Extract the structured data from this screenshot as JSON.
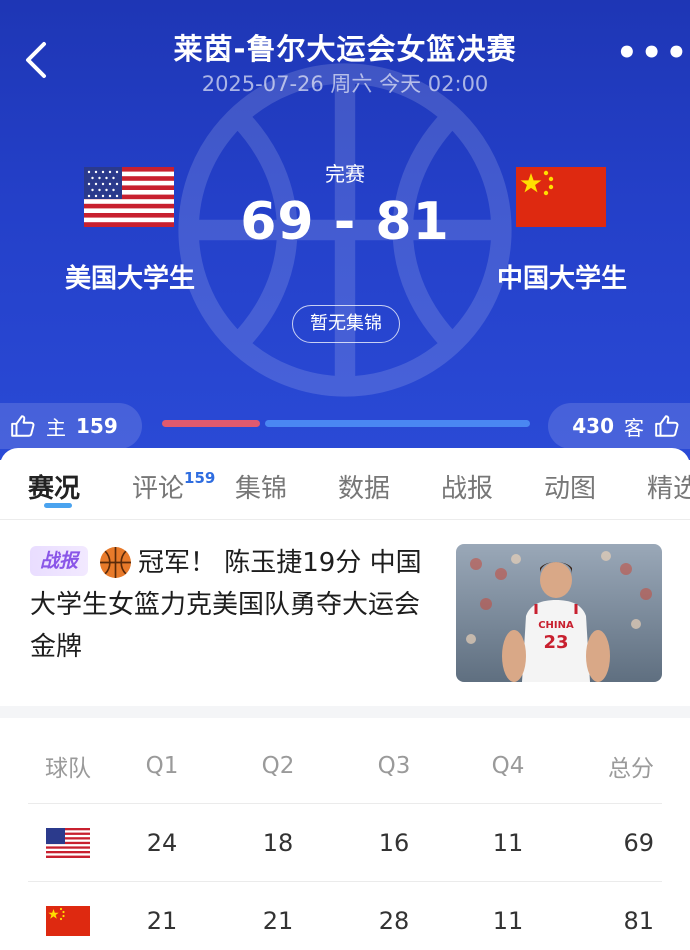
{
  "header": {
    "title": "莱茵-鲁尔大运会女篮决赛",
    "date": "2025-07-26 周六 今天 02:00",
    "status": "完赛",
    "score": "69 - 81",
    "home_team": "美国大学生",
    "away_team": "中国大学生",
    "home_flag": "usa-flag",
    "away_flag": "china-flag",
    "highlights_label": "暂无集锦",
    "more_label": "•••"
  },
  "support": {
    "home_label": "主",
    "home_count": "159",
    "away_label": "客",
    "away_count": "430",
    "home_share": 0.27,
    "home_color": "#e05a6e",
    "away_color": "#4a87f2"
  },
  "tabs": [
    {
      "label": "赛况",
      "active": true
    },
    {
      "label": "评论",
      "badge": "159"
    },
    {
      "label": "集锦"
    },
    {
      "label": "数据"
    },
    {
      "label": "战报"
    },
    {
      "label": "动图"
    },
    {
      "label": "精选"
    }
  ],
  "news": {
    "badge": "战报",
    "icon": "basketball-icon",
    "text": "冠军！ 陈玉捷19分 中国大学生女篮力克美国队勇夺大运会金牌",
    "thumb_jersey_text": "CHINA",
    "thumb_jersey_number": "23"
  },
  "score_table": {
    "headers": [
      "球队",
      "Q1",
      "Q2",
      "Q3",
      "Q4",
      "总分"
    ],
    "rows": [
      {
        "team_flag": "usa-flag",
        "q": [
          "24",
          "18",
          "16",
          "11"
        ],
        "total": "69"
      },
      {
        "team_flag": "china-flag",
        "q": [
          "21",
          "21",
          "28",
          "11"
        ],
        "total": "81"
      }
    ]
  },
  "colors": {
    "header_blue": "#2440c9",
    "accent_blue": "#2f6de0",
    "tab_underline": "#4aa3ef"
  }
}
